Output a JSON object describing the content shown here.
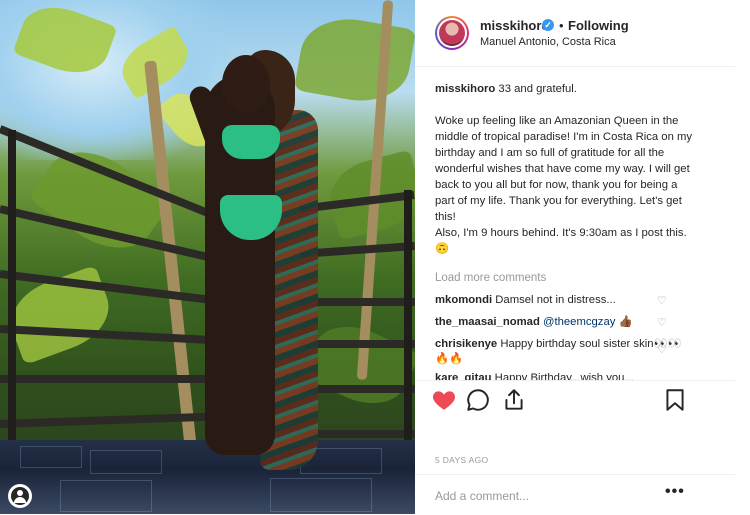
{
  "post": {
    "username": "misskihoro",
    "follow_status": "Following",
    "separator": "•",
    "location": "Manuel Antonio, Costa Rica",
    "caption_line1": "33 and grateful.",
    "caption_para2": "Woke up feeling like an Amazonian Queen in the middle of tropical paradise! I'm in Costa Rica on my birthday and I am so full of gratitude for all the wonderful wishes that have come my way. I will get back to you all but for now, thank you for being a part of my life. Thank you for everything. Let's get this!",
    "caption_para3": "Also, I'm 9 hours behind. It's 9:30am as I post this. 🙃",
    "load_more": "Load more comments",
    "date": "5 DAYS AGO",
    "add_comment_placeholder": "Add a comment...",
    "more": "•••"
  },
  "comments": [
    {
      "user": "mkomondi",
      "text": "Damsel not in distress..."
    },
    {
      "user": "the_maasai_nomad",
      "mention": "@theemcgzay",
      "text": " 👍🏾"
    },
    {
      "user": "chrisikenye",
      "text": "Happy birthday soul sister skin👀👀🔥🔥"
    },
    {
      "user": "kare_gitau",
      "text": "Happy Birthday...wish you..."
    }
  ],
  "icons": {
    "verified": "verified-badge-icon",
    "like": "heart-icon",
    "comment": "comment-icon",
    "share": "share-icon",
    "save": "bookmark-icon",
    "comment_like": "small-heart-icon"
  },
  "colors": {
    "liked_heart": "#ed4956",
    "verified_blue": "#3897f0",
    "muted_text": "#999999"
  }
}
